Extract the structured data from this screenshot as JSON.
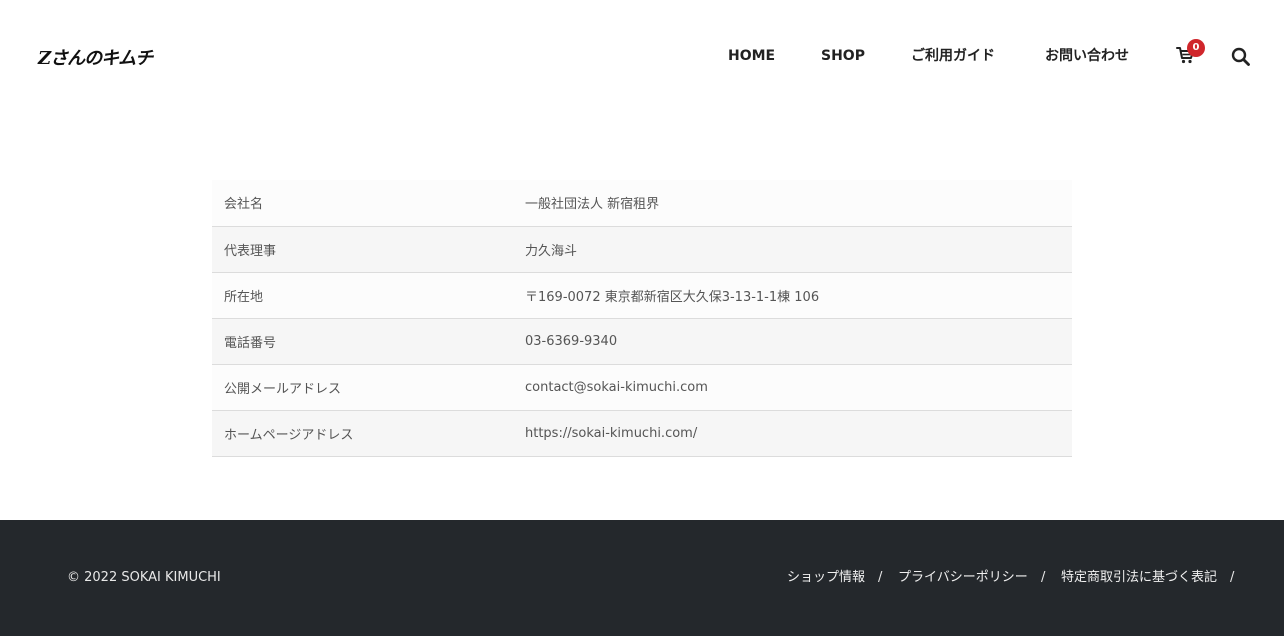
{
  "header": {
    "logo_text": "Zさんのキムチ",
    "nav": [
      {
        "label": "HOME"
      },
      {
        "label": "SHOP"
      },
      {
        "label": "ご利用ガイド"
      },
      {
        "label": "お問い合わせ"
      }
    ],
    "cart_count": "0",
    "cart_icon": "cart-icon",
    "search_icon": "search-icon",
    "badge_color": "#d0262b"
  },
  "company": {
    "rows": [
      {
        "label": "会社名",
        "value": "一般社団法人 新宿租界"
      },
      {
        "label": "代表理事",
        "value": "力久海斗"
      },
      {
        "label": "所在地",
        "value": "〒169-0072 東京都新宿区大久保3-13-1-1棟 106"
      },
      {
        "label": "電話番号",
        "value": "03-6369-9340"
      },
      {
        "label": "公開メールアドレス",
        "value": "contact@sokai-kimuchi.com"
      },
      {
        "label": "ホームページアドレス",
        "value": "https://sokai-kimuchi.com/"
      }
    ]
  },
  "footer": {
    "copyright": "© 2022 SOKAI KIMUCHI",
    "links": [
      {
        "label": "ショップ情報"
      },
      {
        "label": "プライバシーポリシー"
      },
      {
        "label": "特定商取引法に基づく表記"
      }
    ],
    "separator": "/",
    "background": "#24282c"
  }
}
